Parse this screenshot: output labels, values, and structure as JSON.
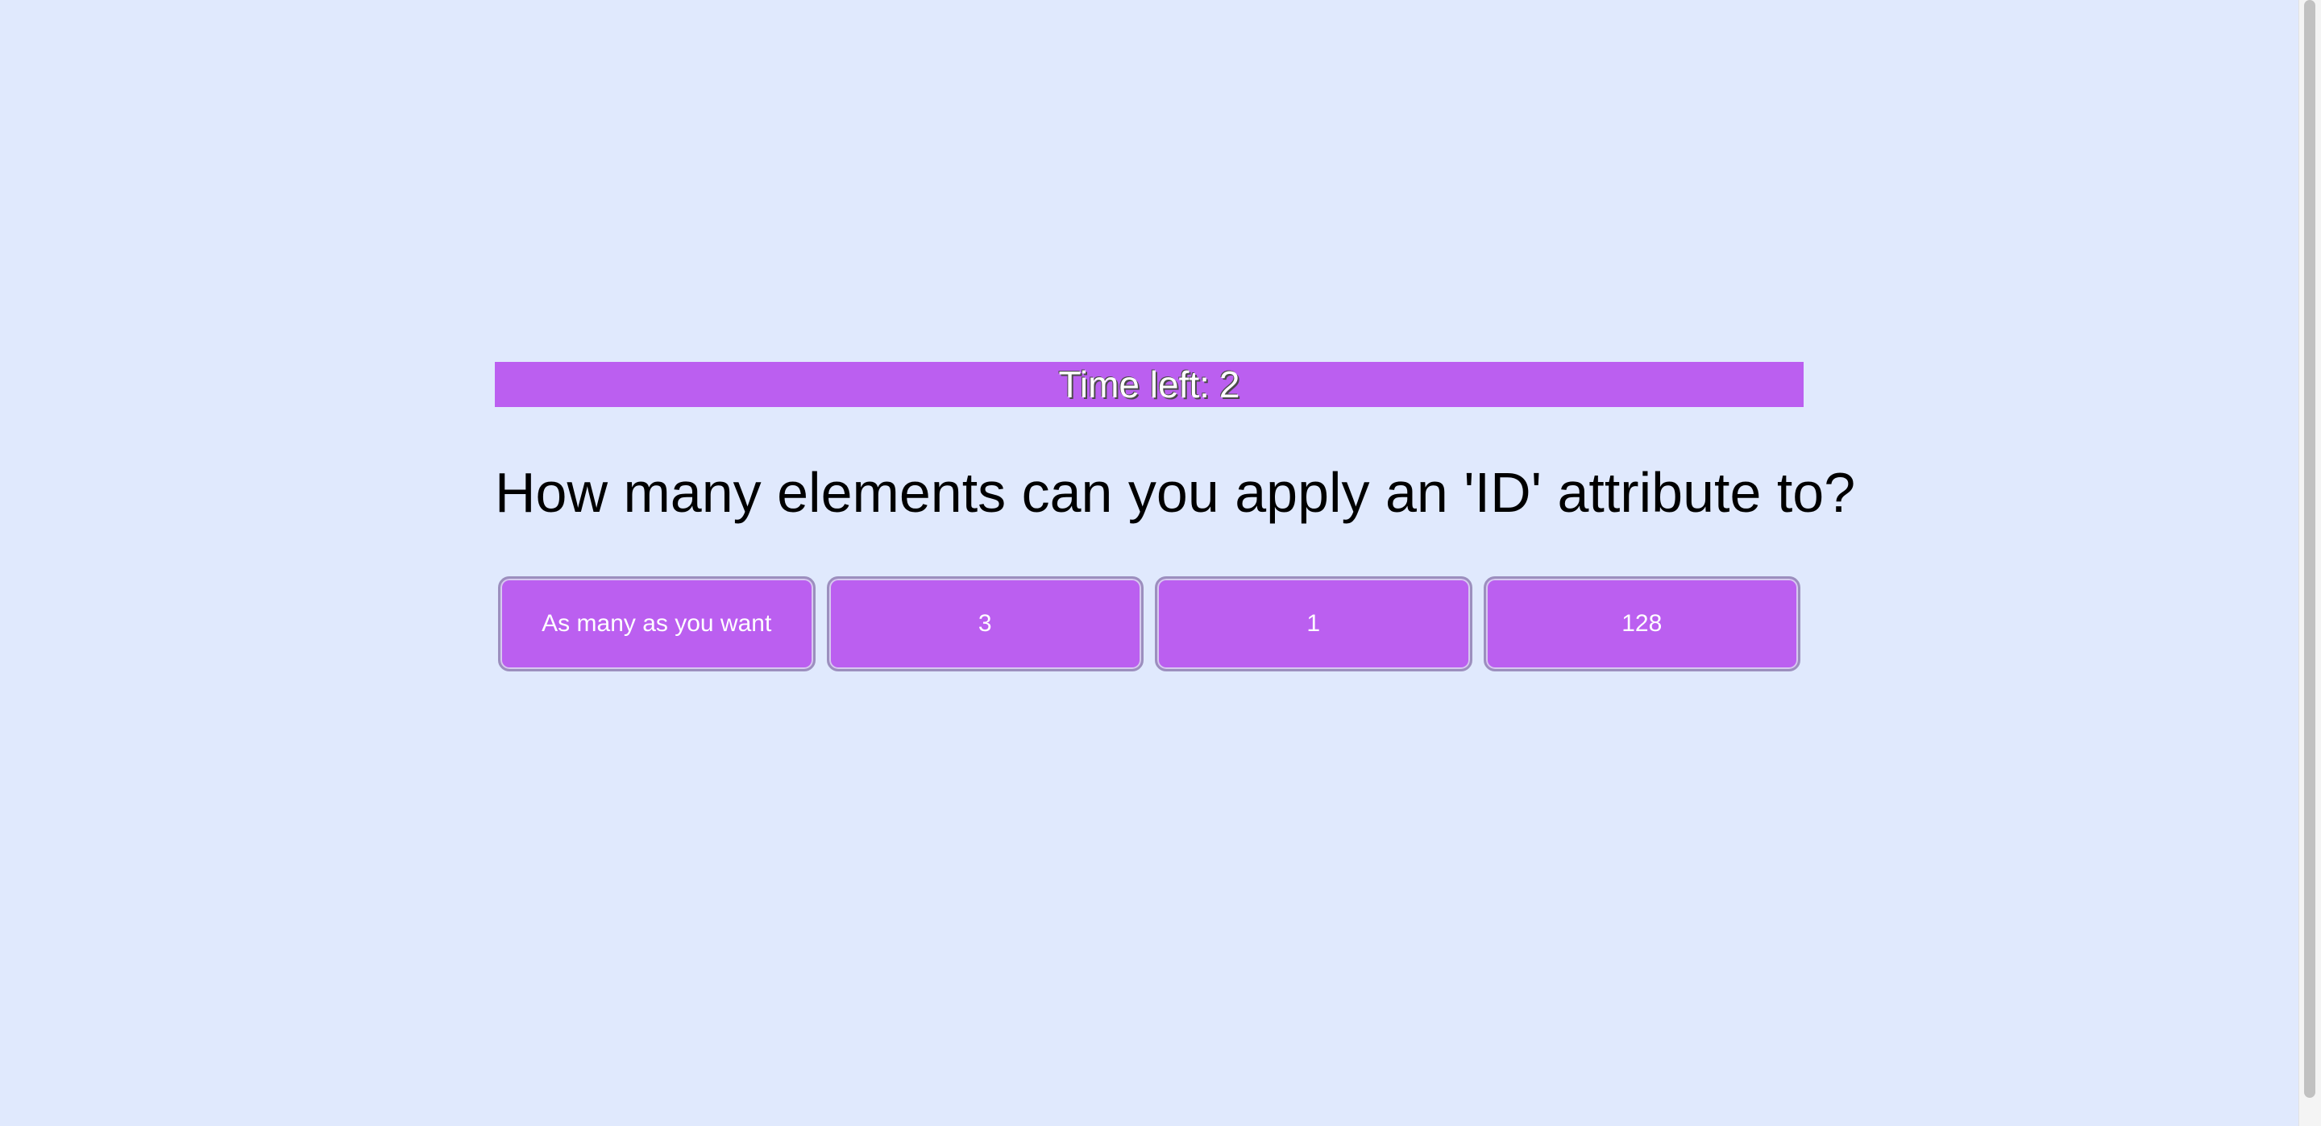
{
  "timer": {
    "label": "Time left:",
    "value": "2"
  },
  "question": {
    "text": "How many elements can you apply an 'ID' attribute to?"
  },
  "answers": [
    {
      "label": "As many as you want"
    },
    {
      "label": "3"
    },
    {
      "label": "1"
    },
    {
      "label": "128"
    }
  ],
  "colors": {
    "background": "#e0e9fd",
    "accent": "#bb5ff0",
    "button_border": "#9c8fbe",
    "text_dark": "#000000",
    "text_light": "#ffffff"
  }
}
